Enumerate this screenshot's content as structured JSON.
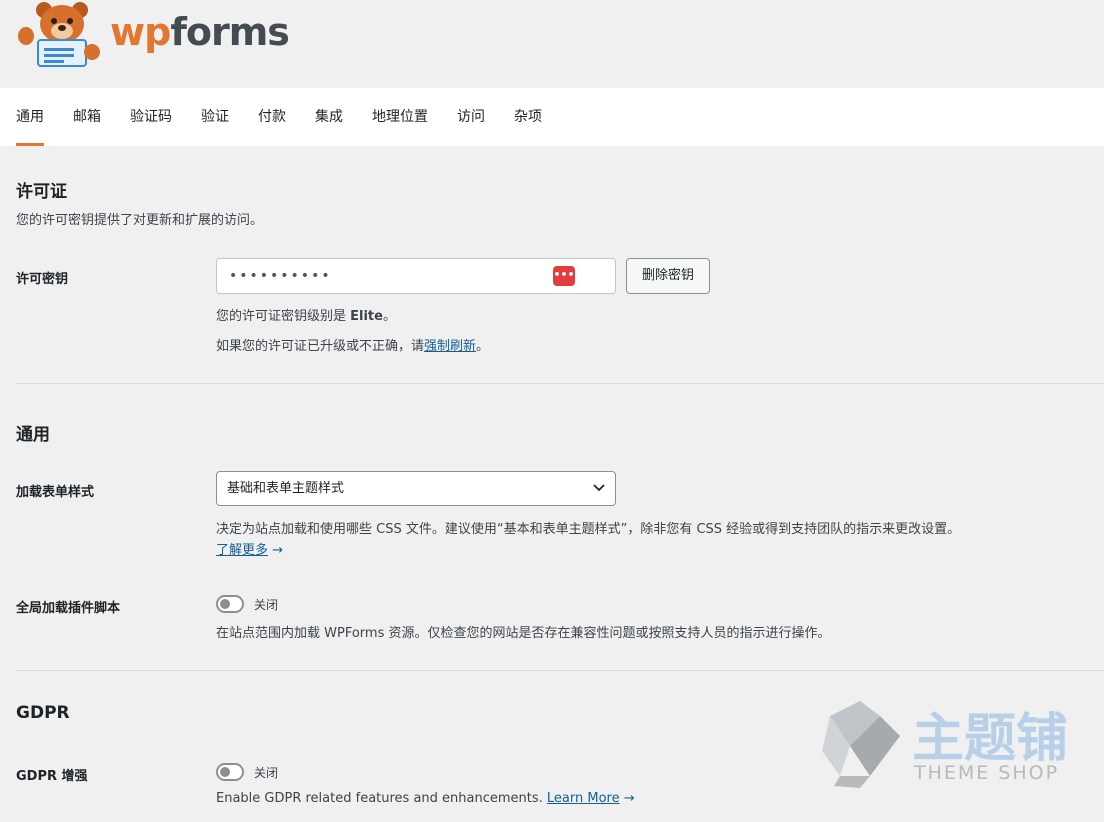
{
  "brand": {
    "wp": "wp",
    "forms": "forms",
    "accent": "#e27730"
  },
  "tabs": [
    {
      "label": "通用",
      "active": true
    },
    {
      "label": "邮箱"
    },
    {
      "label": "验证码"
    },
    {
      "label": "验证"
    },
    {
      "label": "付款"
    },
    {
      "label": "集成"
    },
    {
      "label": "地理位置"
    },
    {
      "label": "访问"
    },
    {
      "label": "杂项"
    }
  ],
  "license": {
    "title": "许可证",
    "desc": "您的许可密钥提供了对更新和扩展的访问。",
    "key_label": "许可密钥",
    "key_value": "••••••••••",
    "delete_button": "删除密钥",
    "level_prefix": "您的许可证密钥级别是 ",
    "level_value": "Elite",
    "level_suffix": "。",
    "refresh_prefix": "如果您的许可证已升级或不正确，请",
    "refresh_link": "强制刷新",
    "refresh_suffix": "。"
  },
  "general": {
    "title": "通用",
    "styles_label": "加载表单样式",
    "styles_value": "基础和表单主题样式",
    "styles_desc": "决定为站点加载和使用哪些 CSS 文件。建议使用“基本和表单主题样式”，除非您有 CSS 经验或得到支持团队的指示来更改设置。",
    "learn_more": "了解更多",
    "global_label": "全局加载插件脚本",
    "global_state": "关闭",
    "global_desc": "在站点范围内加载 WPForms 资源。仅检查您的网站是否存在兼容性问题或按照支持人员的指示进行操作。"
  },
  "gdpr": {
    "title": "GDPR",
    "label": "GDPR 增强",
    "state": "关闭",
    "desc": "Enable GDPR related features and enhancements. ",
    "learn_more": "Learn More"
  },
  "watermark": {
    "cn": "主题铺",
    "en": "THEME SHOP"
  },
  "icons": {
    "arrow": "→",
    "chevron": "⌄",
    "password": "•••"
  }
}
